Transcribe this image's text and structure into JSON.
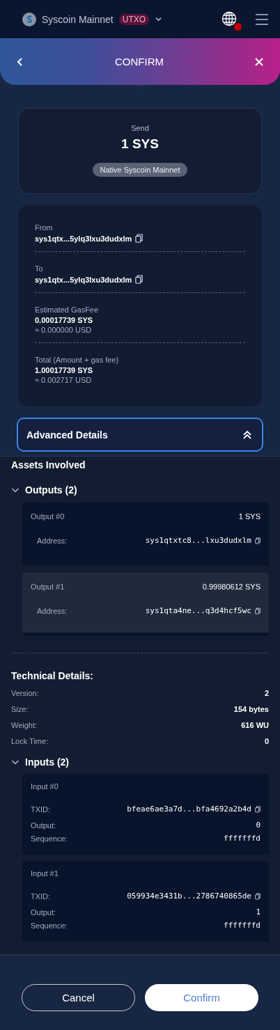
{
  "header": {
    "network": "Syscoin Mainnet",
    "badge": "UTXO",
    "notification": true
  },
  "banner": {
    "title": "CONFIRM"
  },
  "send": {
    "label": "Send",
    "amount": "1 SYS",
    "network_tag": "Native Syscoin Mainnet"
  },
  "details": [
    {
      "label": "From",
      "value": "sys1qtx...5ylq3lxu3dudxlm",
      "copy": true
    },
    {
      "label": "To",
      "value": "sys1qtx...5ylq3lxu3dudxlm",
      "copy": true
    },
    {
      "label": "Estimated GasFee",
      "value": "0.00017739 SYS",
      "sub": "≈ 0.000000 USD",
      "copy": false
    },
    {
      "label": "Total (Amount + gas fee)",
      "value": "1.00017739 SYS",
      "sub": "≈ 0.002717 USD",
      "copy": false
    }
  ],
  "advanced": {
    "label": "Advanced Details",
    "expanded": true
  },
  "assets_title": "Assets Involved",
  "outputs": {
    "title": "Outputs (2)",
    "expanded": true,
    "items": [
      {
        "name": "Output #0",
        "amount": "1 SYS",
        "address_label": "Address:",
        "address": "sys1qtxtc8...lxu3dudxlm",
        "highlighted": false
      },
      {
        "name": "Output #1",
        "amount": "0.99980612 SYS",
        "address_label": "Address:",
        "address": "sys1qta4ne...q3d4hcf5wc",
        "highlighted": true
      }
    ]
  },
  "technical": {
    "title": "Technical Details:",
    "rows": [
      {
        "label": "Version:",
        "value": "2"
      },
      {
        "label": "Size:",
        "value": "154 bytes"
      },
      {
        "label": "Weight:",
        "value": "616 WU"
      },
      {
        "label": "Lock Time:",
        "value": "0"
      }
    ]
  },
  "inputs": {
    "title": "Inputs (2)",
    "expanded": true,
    "items": [
      {
        "name": "Input #0",
        "txid_label": "TXID:",
        "txid": "bfeae6ae3a7d...bfa4692a2b4d",
        "output_label": "Output:",
        "output": "0",
        "sequence_label": "Sequence:",
        "sequence": "fffffffd"
      },
      {
        "name": "Input #1",
        "txid_label": "TXID:",
        "txid": "059934e3431b...2786740865de",
        "output_label": "Output:",
        "output": "1",
        "sequence_label": "Sequence:",
        "sequence": "fffffffd"
      }
    ]
  },
  "buttons": [
    {
      "label": "Cancel",
      "kind": "secondary"
    },
    {
      "label": "Confirm",
      "kind": "primary"
    }
  ]
}
